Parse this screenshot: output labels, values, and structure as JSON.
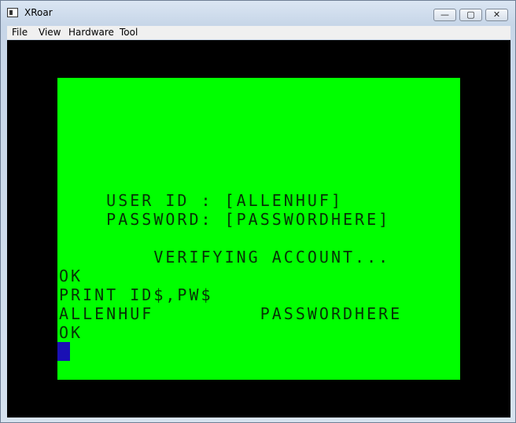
{
  "window": {
    "title": "XRoar",
    "min_glyph": "—",
    "max_glyph": "▢",
    "close_glyph": "✕"
  },
  "menu": {
    "items": [
      "File",
      "View",
      "Hardware",
      "Tool"
    ]
  },
  "screen": {
    "lines": [
      "",
      "",
      "",
      "",
      "",
      "",
      "    USER ID : [ALLENHUF]",
      "    PASSWORD: [PASSWORDHERE]",
      "",
      "        VERIFYING ACCOUNT...",
      "OK",
      "PRINT ID$,PW$",
      "ALLENHUF         PASSWORDHERE",
      "OK"
    ],
    "background_color": "#00ff00",
    "text_color": "#063206",
    "cursor_color": "#1a10b4"
  }
}
